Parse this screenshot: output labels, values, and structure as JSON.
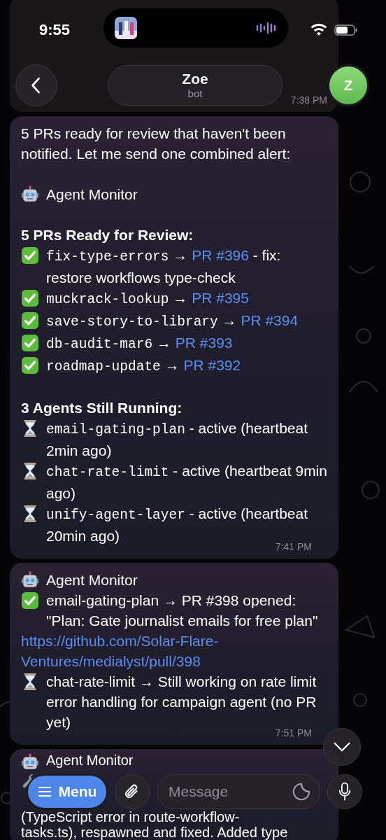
{
  "status_bar": {
    "time": "9:55"
  },
  "header": {
    "title": "Zoe",
    "subtitle": "bot",
    "avatar": "Z"
  },
  "messages": [
    {
      "kind": "partial",
      "time": "7:38 PM"
    },
    {
      "kind": "full",
      "time": "7:41 PM",
      "lines": [
        {
          "kind": "text",
          "segments": [
            {
              "text": "5 PRs ready for review that haven't been notified. Let me send one combined alert:"
            }
          ]
        },
        {
          "kind": "blank"
        },
        {
          "kind": "robot",
          "segments": [
            {
              "text": "Agent Monitor"
            }
          ]
        },
        {
          "kind": "blank"
        },
        {
          "kind": "heading",
          "segments": [
            {
              "text": "5 PRs Ready for Review:"
            }
          ]
        },
        {
          "kind": "done",
          "segments": [
            {
              "code": "fix-type-errors"
            },
            {
              "text": " → "
            },
            {
              "link": "PR #396"
            },
            {
              "text": " - fix: restore workflows type-check"
            }
          ]
        },
        {
          "kind": "done",
          "segments": [
            {
              "code": "muckrack-lookup"
            },
            {
              "text": " → "
            },
            {
              "link": "PR #395"
            }
          ]
        },
        {
          "kind": "done",
          "segments": [
            {
              "code": "save-story-to-library"
            },
            {
              "text": " → "
            },
            {
              "link": "PR #394"
            }
          ]
        },
        {
          "kind": "done",
          "segments": [
            {
              "code": "db-audit-mar6"
            },
            {
              "text": " → "
            },
            {
              "link": "PR #393"
            }
          ]
        },
        {
          "kind": "done",
          "segments": [
            {
              "code": "roadmap-update"
            },
            {
              "text": " → "
            },
            {
              "link": "PR #392"
            }
          ]
        },
        {
          "kind": "blank"
        },
        {
          "kind": "heading",
          "segments": [
            {
              "text": "3 Agents Still Running:"
            }
          ]
        },
        {
          "kind": "running",
          "segments": [
            {
              "code": "email-gating-plan"
            },
            {
              "text": " - active (heartbeat 2min ago)"
            }
          ]
        },
        {
          "kind": "running",
          "segments": [
            {
              "code": "chat-rate-limit"
            },
            {
              "text": " - active (heartbeat 9min ago)"
            }
          ]
        },
        {
          "kind": "running",
          "segments": [
            {
              "code": "unify-agent-layer"
            },
            {
              "text": " - active (heartbeat 20min ago)"
            }
          ]
        }
      ]
    },
    {
      "kind": "full",
      "time": "7:51 PM",
      "lines": [
        {
          "kind": "robot",
          "segments": [
            {
              "text": "Agent Monitor"
            }
          ]
        },
        {
          "kind": "done",
          "segments": [
            {
              "text": "email-gating-plan → PR #398 opened: \"Plan: Gate journalist emails for free plan\""
            }
          ]
        },
        {
          "kind": "url",
          "segments": [
            {
              "url": "https://github.com/Solar-Flare-Ventures/medialyst/pull/398"
            }
          ]
        },
        {
          "kind": "running",
          "segments": [
            {
              "text": "chat-rate-limit → Still working on rate limit error handling for campaign agent (no PR yet)"
            }
          ]
        }
      ]
    },
    {
      "kind": "full",
      "lines": [
        {
          "kind": "robot",
          "segments": [
            {
              "text": "Agent Monitor"
            }
          ]
        },
        {
          "kind": "fix"
        },
        {
          "kind": "text",
          "segments": [
            {
              "text": "(TypeScript error in route-workflow-"
            }
          ]
        },
        {
          "kind": "text",
          "segments": [
            {
              "text": "tasks.ts), respawned and fixed. Added type"
            }
          ]
        }
      ]
    }
  ],
  "composer": {
    "menu": "Menu",
    "placeholder": "Message"
  }
}
